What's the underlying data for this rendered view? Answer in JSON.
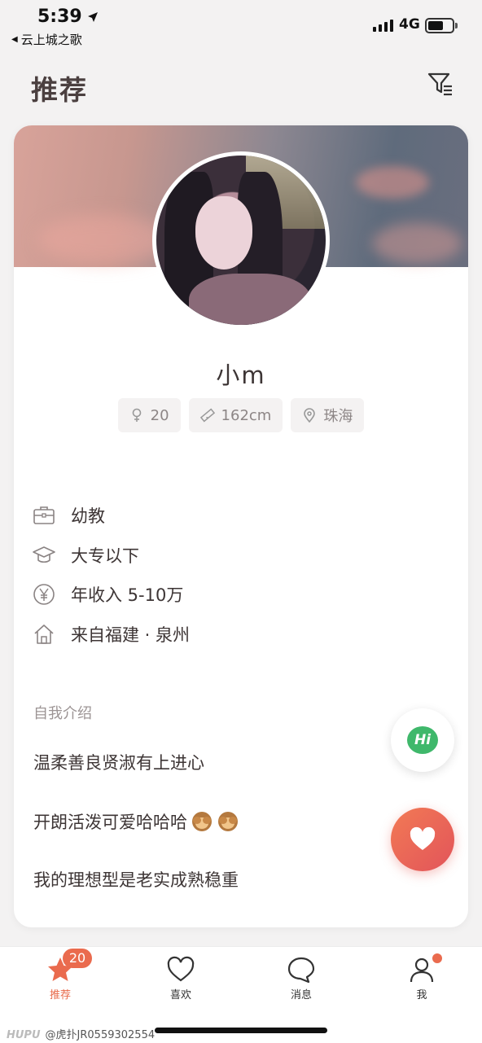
{
  "status_bar": {
    "time": "5:39",
    "back_app": "云上城之歌",
    "network": "4G"
  },
  "header": {
    "title": "推荐",
    "filter_icon": "filter-icon"
  },
  "profile": {
    "name": "小m",
    "tags": [
      {
        "icon": "female-icon",
        "text": "20"
      },
      {
        "icon": "ruler-icon",
        "text": "162cm"
      },
      {
        "icon": "location-pin-icon",
        "text": "珠海"
      }
    ],
    "info": [
      {
        "icon": "briefcase-icon",
        "text": "幼教"
      },
      {
        "icon": "graduation-cap-icon",
        "text": "大专以下"
      },
      {
        "icon": "yen-icon",
        "text": "年收入 5-10万"
      },
      {
        "icon": "home-icon",
        "text": "来自福建 · 泉州"
      }
    ],
    "intro_heading": "自我介绍",
    "intro": [
      "温柔善良贤淑有上进心",
      "开朗活泼可爱哈哈哈",
      "我的理想型是老实成熟稳重"
    ]
  },
  "actions": {
    "hi_label": "Hi"
  },
  "tab_bar": {
    "tabs": [
      {
        "label": "推荐",
        "icon": "star-icon",
        "badge": "20",
        "active": true
      },
      {
        "label": "喜欢",
        "icon": "heart-icon"
      },
      {
        "label": "消息",
        "icon": "chat-bubble-icon"
      },
      {
        "label": "我",
        "icon": "person-icon",
        "dot": true
      }
    ]
  },
  "watermark": {
    "brand": "HUPU",
    "text": "@虎扑JR0559302554"
  },
  "colors": {
    "accent": "#ea6b4e",
    "hi_green": "#3fb86b"
  }
}
